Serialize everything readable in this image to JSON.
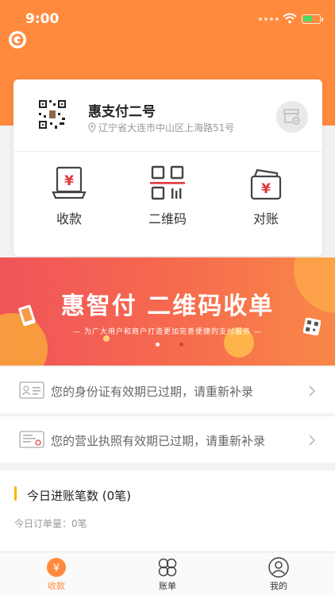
{
  "status_bar": {
    "time": "9:00"
  },
  "merchant": {
    "name": "惠支付二号",
    "address": "辽宁省大连市中山区上海路51号"
  },
  "actions": [
    {
      "label": "收款",
      "icon": "yuan-receipt-icon"
    },
    {
      "label": "二维码",
      "icon": "qr-code-icon"
    },
    {
      "label": "对账",
      "icon": "yuan-cards-icon"
    }
  ],
  "banner": {
    "title": "惠智付  二维码收单",
    "subtitle": "— 为广大用户和商户打造更加完善便捷的支付服务 —"
  },
  "notices": [
    {
      "text": "您的身份证有效期已过期，请重新补录",
      "icon": "id-card-icon"
    },
    {
      "text": "您的营业执照有效期已过期，请重新补录",
      "icon": "license-icon"
    }
  ],
  "stats": {
    "title": "今日进账笔数 (0笔)",
    "subtitle": "今日订单量：0笔"
  },
  "tabbar": [
    {
      "label": "收款",
      "active": true
    },
    {
      "label": "账单",
      "active": false
    },
    {
      "label": "我的",
      "active": false
    }
  ],
  "colors": {
    "brand": "#ff8a3d",
    "accent_red": "#e0383e",
    "active_tab": "#ff8a3d"
  }
}
